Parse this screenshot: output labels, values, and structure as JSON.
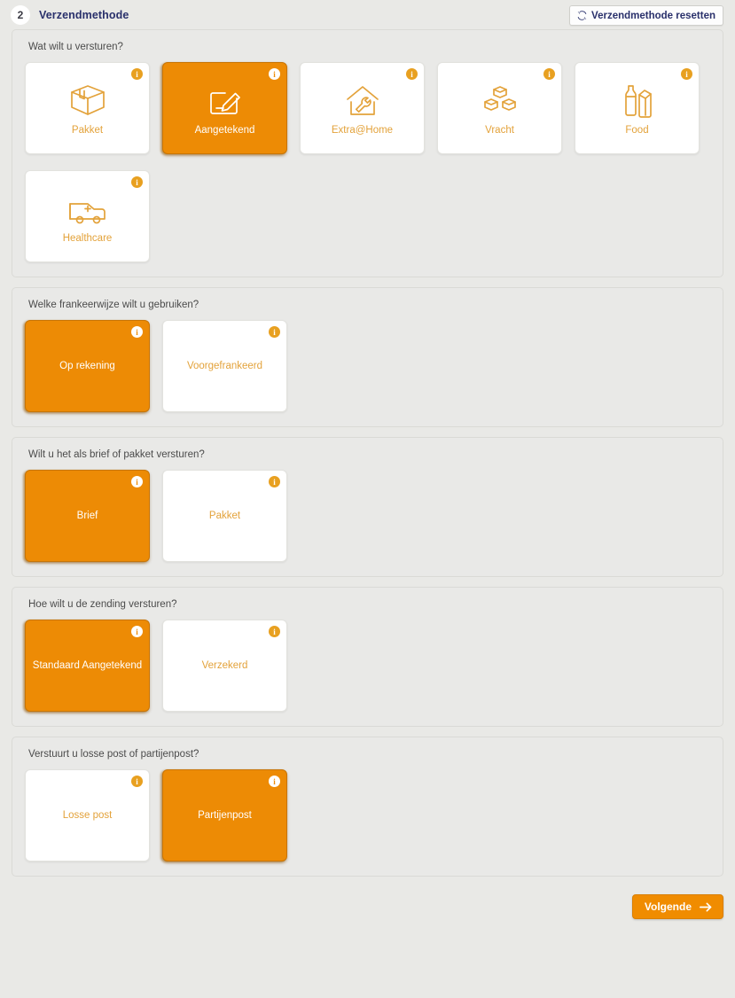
{
  "header": {
    "step_number": "2",
    "title": "Verzendmethode",
    "reset_label": "Verzendmethode resetten",
    "reset_icon": "refresh-icon"
  },
  "info_badge_char": "i",
  "colors": {
    "accent_orange": "#ed8b05",
    "tile_label_orange": "#e3a23a",
    "title_navy": "#29306b",
    "page_background": "#e9e9e6",
    "section_background": "#e9e9e7"
  },
  "sections": [
    {
      "question": "Wat wilt u versturen?",
      "tiles": [
        {
          "label": "Pakket",
          "icon": "box-icon",
          "selected": false
        },
        {
          "label": "Aangetekend",
          "icon": "signature-icon",
          "selected": true
        },
        {
          "label": "Extra@Home",
          "icon": "house-wrench-icon",
          "selected": false
        },
        {
          "label": "Vracht",
          "icon": "pallet-icon",
          "selected": false
        },
        {
          "label": "Food",
          "icon": "bottle-carton-icon",
          "selected": false
        },
        {
          "label": "Healthcare",
          "icon": "ambulance-icon",
          "selected": false
        }
      ]
    },
    {
      "question": "Welke frankeerwijze wilt u gebruiken?",
      "tiles": [
        {
          "label": "Op rekening",
          "icon": "none",
          "selected": true
        },
        {
          "label": "Voorgefrankeerd",
          "icon": "none",
          "selected": false
        }
      ]
    },
    {
      "question": "Wilt u het als brief of pakket versturen?",
      "tiles": [
        {
          "label": "Brief",
          "icon": "none",
          "selected": true
        },
        {
          "label": "Pakket",
          "icon": "none",
          "selected": false
        }
      ]
    },
    {
      "question": "Hoe wilt u de zending versturen?",
      "tiles": [
        {
          "label": "Standaard Aangetekend",
          "icon": "none",
          "selected": true
        },
        {
          "label": "Verzekerd",
          "icon": "none",
          "selected": false
        }
      ]
    },
    {
      "question": "Verstuurt u losse post of partijenpost?",
      "tiles": [
        {
          "label": "Losse post",
          "icon": "none",
          "selected": false
        },
        {
          "label": "Partijenpost",
          "icon": "none",
          "selected": true
        }
      ]
    }
  ],
  "footer": {
    "next_label": "Volgende",
    "next_icon": "arrow-right-icon"
  }
}
